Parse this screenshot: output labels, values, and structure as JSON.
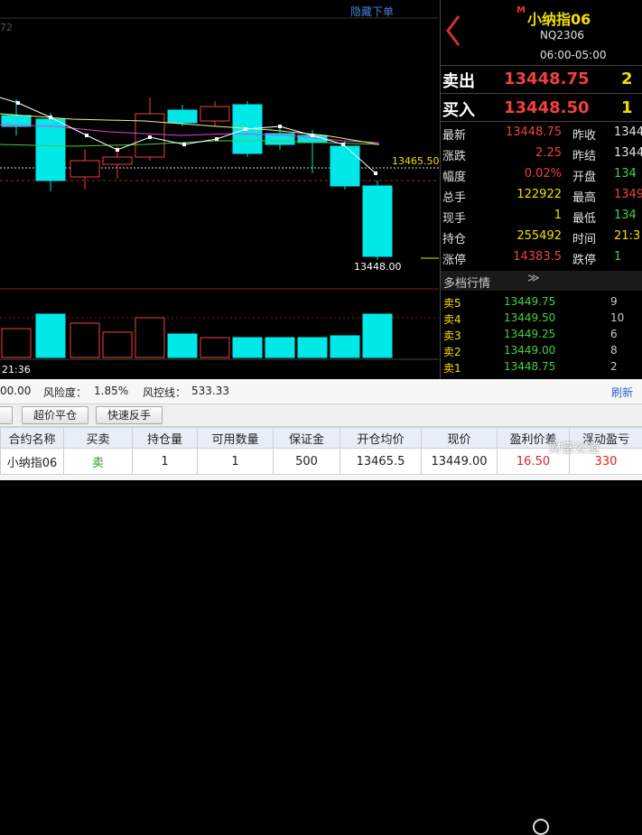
{
  "chart": {
    "hide_orders_link": "隐藏下单",
    "corner_value": "72",
    "last_price_label": "13465.50",
    "low_label": "13448.00",
    "time_label": "21:36"
  },
  "instrument": {
    "marker": "M",
    "name": "小纳指06",
    "code": "NQ2306",
    "hours": "06:00-05:00"
  },
  "order_book_top": {
    "sell_label": "卖出",
    "sell_price": "13448.75",
    "sell_qty": "2",
    "buy_label": "买入",
    "buy_price": "13448.50",
    "buy_qty": "1"
  },
  "quote": {
    "rows": [
      {
        "l1": "最新",
        "v1": "13448.75",
        "c1": "#f04040",
        "l2": "昨收",
        "v2": "1344",
        "c2": "#e0e0e0"
      },
      {
        "l1": "涨跌",
        "v1": "2.25",
        "c1": "#f04040",
        "l2": "昨结",
        "v2": "1344",
        "c2": "#e0e0e0"
      },
      {
        "l1": "幅度",
        "v1": "0.02%",
        "c1": "#f04040",
        "l2": "开盘",
        "v2": "134",
        "c2": "#3fd43f"
      },
      {
        "l1": "总手",
        "v1": "122922",
        "c1": "#f0e000",
        "l2": "最高",
        "v2": "1349",
        "c2": "#f04040"
      },
      {
        "l1": "现手",
        "v1": "1",
        "c1": "#f0e000",
        "l2": "最低",
        "v2": "134",
        "c2": "#3fd43f"
      },
      {
        "l1": "持仓",
        "v1": "255492",
        "c1": "#f0e000",
        "l2": "时间",
        "v2": "21:3",
        "c2": "#f0e000"
      },
      {
        "l1": "涨停",
        "v1": "14383.5",
        "c1": "#f04040",
        "l2": "跌停",
        "v2": "1",
        "c2": "#3fd43f"
      }
    ]
  },
  "depth": {
    "title": "多档行情",
    "chevron": "≫",
    "rows": [
      {
        "label": "卖5",
        "price": "13449.75",
        "qty": "9"
      },
      {
        "label": "卖4",
        "price": "13449.50",
        "qty": "10"
      },
      {
        "label": "卖3",
        "price": "13449.25",
        "qty": "6"
      },
      {
        "label": "卖2",
        "price": "13449.00",
        "qty": "8"
      },
      {
        "label": "卖1",
        "price": "13448.75",
        "qty": "2"
      }
    ]
  },
  "account": {
    "balance_fragment": "00.00",
    "risk_label": "风险度：",
    "risk_value": "1.85%",
    "control_label": "风控线：",
    "control_value": "533.33",
    "refresh": "刷新"
  },
  "actions": {
    "super_close": "超价平仓",
    "quick_reverse": "快速反手"
  },
  "positions": {
    "headers": [
      "合约名称",
      "买卖",
      "持仓量",
      "可用数量",
      "保证金",
      "开仓均价",
      "现价",
      "盈利价差",
      "浮动盈亏"
    ],
    "rows": [
      {
        "name": "小纳指06",
        "side": "卖",
        "qty": "1",
        "avail": "1",
        "margin": "500",
        "open_avg": "13465.5",
        "last": "13449.00",
        "spread": "16.50",
        "pnl": "330"
      }
    ]
  },
  "watermark": "财富公道"
}
